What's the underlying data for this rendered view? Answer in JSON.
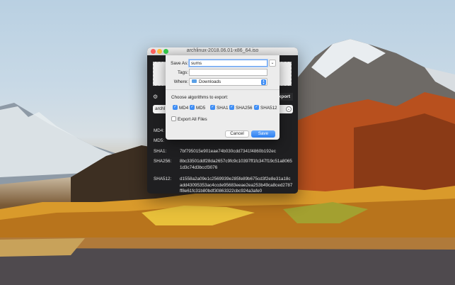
{
  "window": {
    "title": "archlinux-2018.06.01-x86_64.iso",
    "export_label": "Export",
    "file_select_value": "archl",
    "hashes": [
      {
        "label": "MD4:",
        "value": ""
      },
      {
        "label": "MD5:",
        "value": ""
      },
      {
        "label": "SHA1:",
        "value": "7bf795015e901eae74b030cdd7341f4860b192ec"
      },
      {
        "label": "SHA256:",
        "value": "8bc33501ddf28da2657c9fc9c10397ff1fc347f19c51a80651d3c74d3bccf3076"
      },
      {
        "label": "SHA512:",
        "value": "d1558a2a09e1c2569939e285fe89b675cd3f2e8e31a18cadd43095353ac4ccde95683eeae2ea253b49ca8ced2787ff8e61fc31b80bdf30863322cbc924a3afe0"
      }
    ]
  },
  "sheet": {
    "save_as_label": "Save As:",
    "save_as_value": "sums",
    "tags_label": "Tags:",
    "tags_value": "",
    "where_label": "Where:",
    "where_value": "Downloads",
    "algo_title": "Choose algorithms to export:",
    "algorithms": [
      {
        "label": "MD4",
        "checked": true
      },
      {
        "label": "MD5",
        "checked": true
      },
      {
        "label": "SHA1",
        "checked": true
      },
      {
        "label": "SHA256",
        "checked": true
      },
      {
        "label": "SHA512",
        "checked": true
      }
    ],
    "export_all_label": "Export All Files",
    "export_all_checked": false,
    "cancel_label": "Cancel",
    "save_label": "Save"
  },
  "icons": {
    "gear": "gear-icon",
    "folder": "folder-icon",
    "expand": "chevron-down-icon",
    "stepper": "updown-chevron-icon"
  },
  "colors": {
    "accent": "#3f8ef5",
    "close": "#fc605c",
    "minimize": "#fdbc40",
    "maximize": "#34c84a"
  }
}
